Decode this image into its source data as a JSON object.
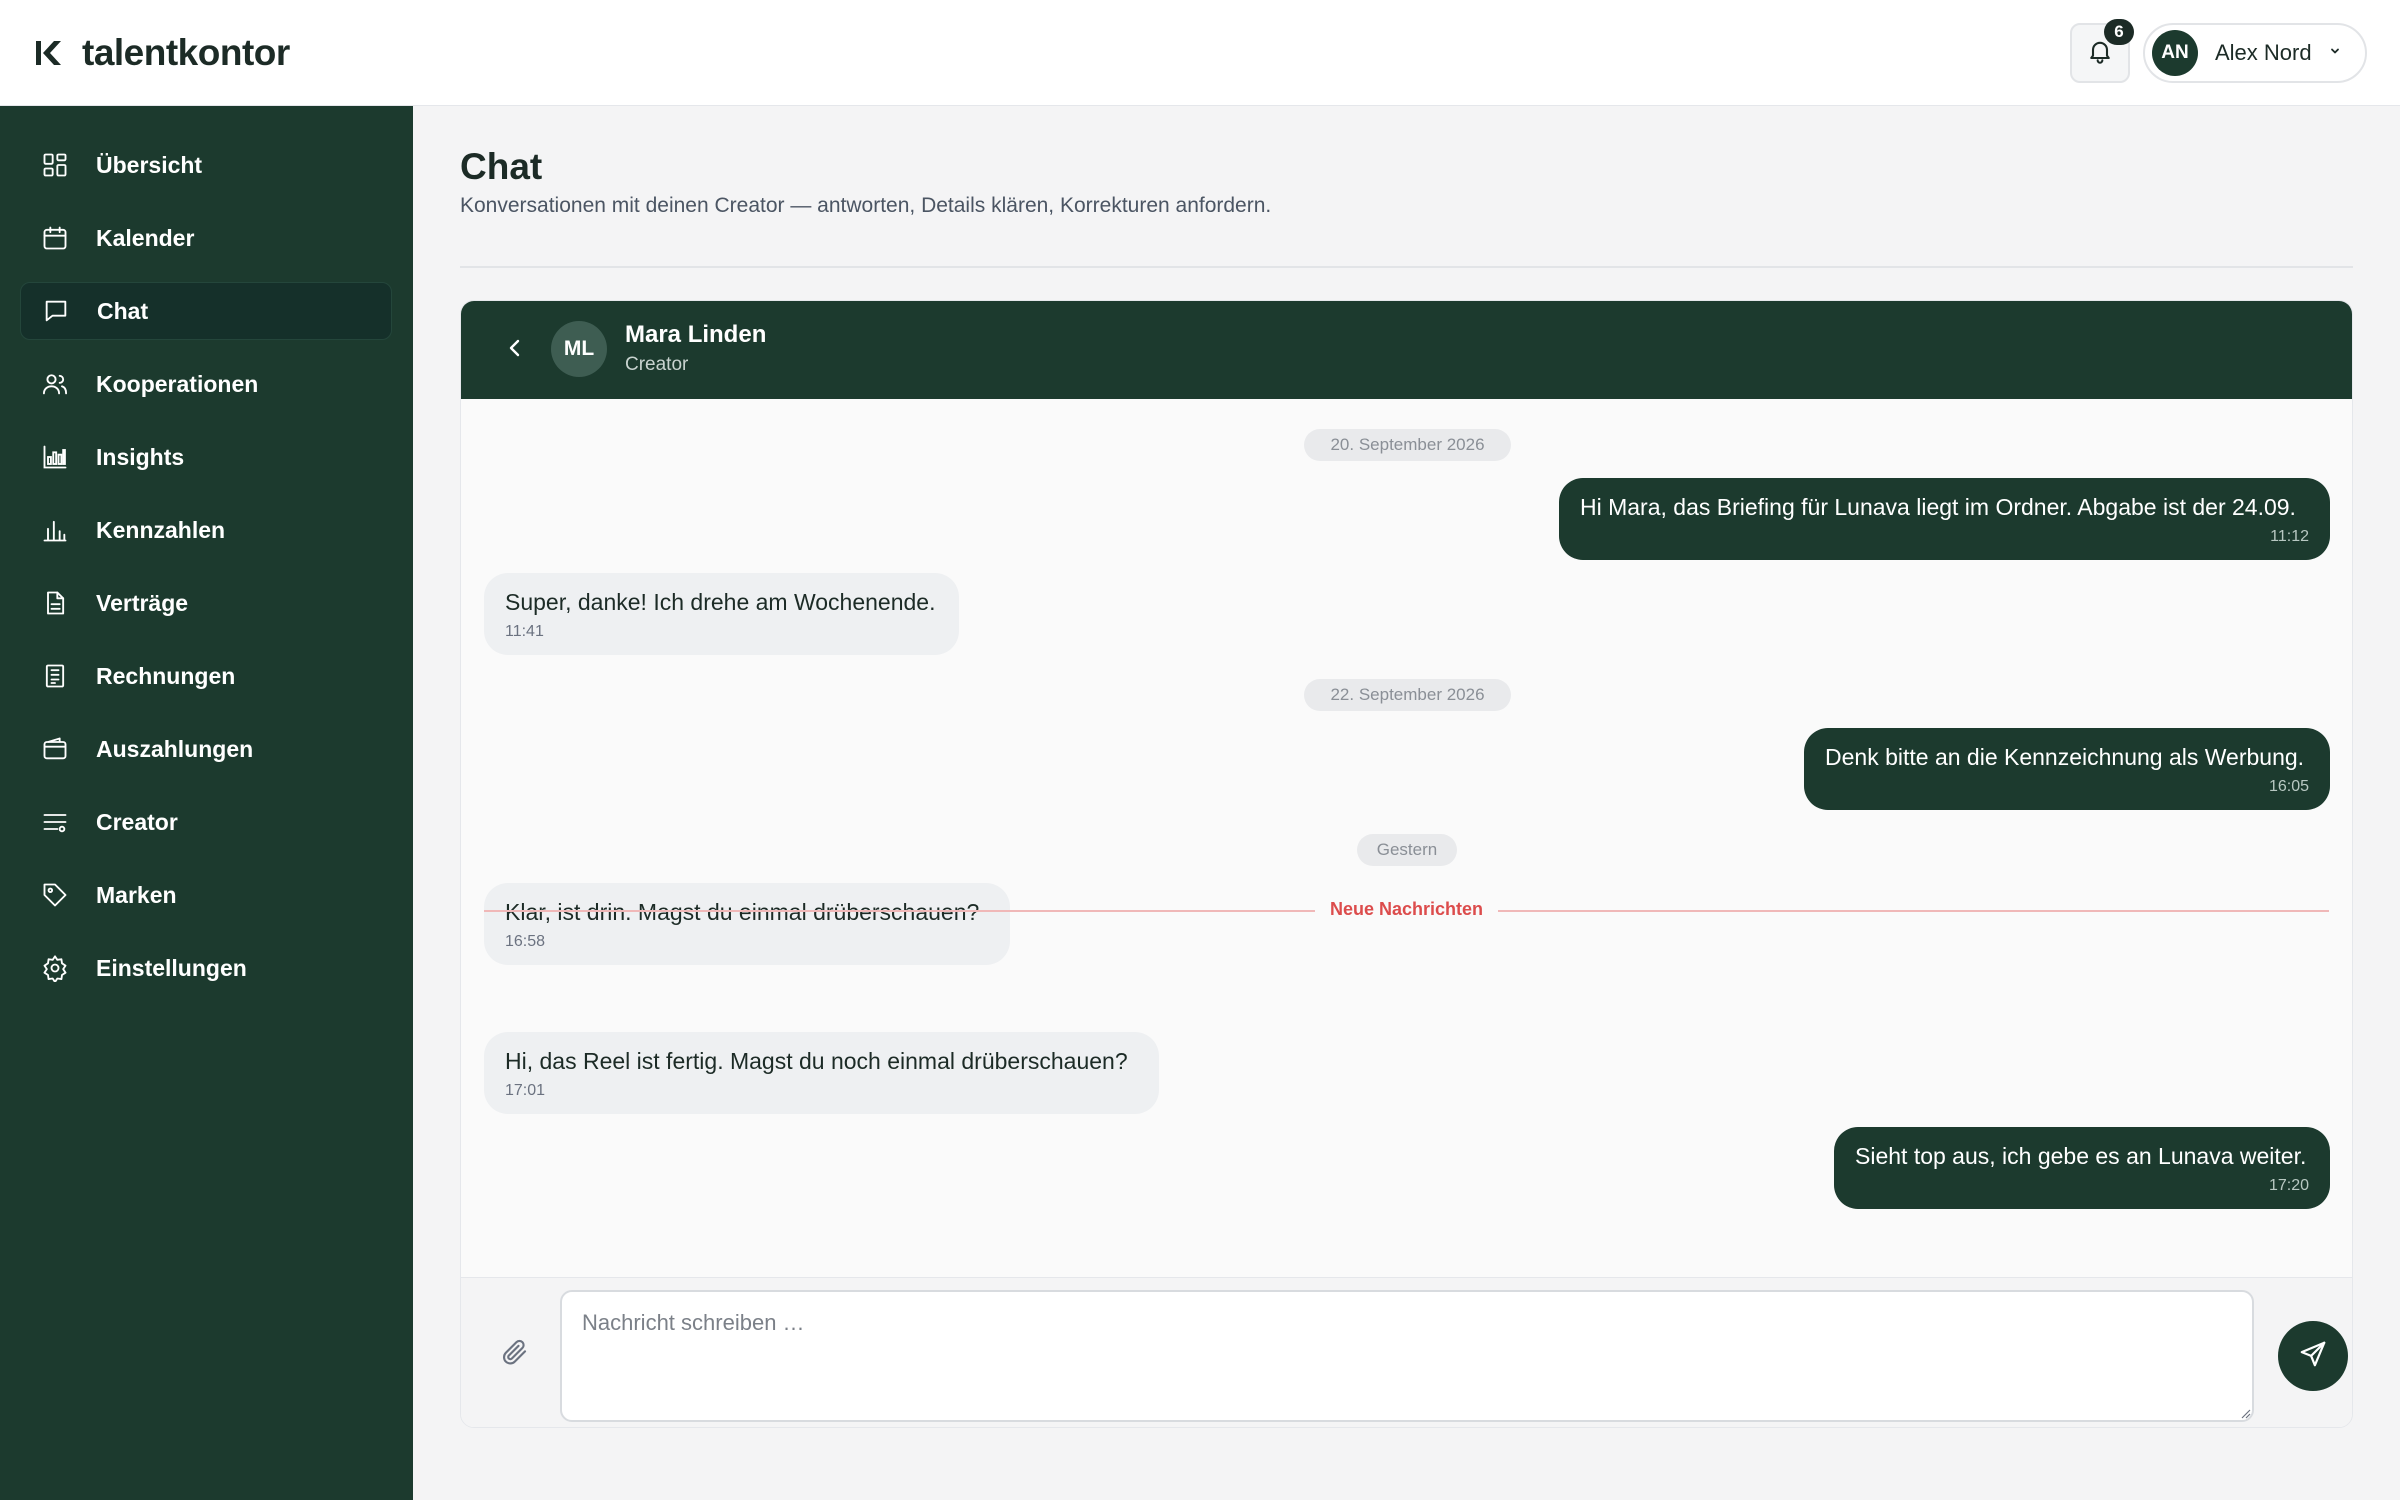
{
  "brand": {
    "name": "talentkontor",
    "logo_icon": "k-logo-icon"
  },
  "header": {
    "notifications_count": "6",
    "user": {
      "initials": "AN",
      "name": "Alex Nord"
    }
  },
  "sidebar": {
    "items": [
      {
        "label": "Übersicht",
        "icon": "grid-icon"
      },
      {
        "label": "Kalender",
        "icon": "calendar-icon"
      },
      {
        "label": "Chat",
        "icon": "chat-icon",
        "active": true
      },
      {
        "label": "Kooperationen",
        "icon": "users-icon"
      },
      {
        "label": "Insights",
        "icon": "bar-chart-icon"
      },
      {
        "label": "Kennzahlen",
        "icon": "metrics-icon"
      },
      {
        "label": "Verträge",
        "icon": "document-icon"
      },
      {
        "label": "Rechnungen",
        "icon": "receipt-icon"
      },
      {
        "label": "Auszahlungen",
        "icon": "wallet-icon"
      },
      {
        "label": "Creator",
        "icon": "list-filter-icon"
      },
      {
        "label": "Marken",
        "icon": "tag-icon"
      },
      {
        "label": "Einstellungen",
        "icon": "gear-icon"
      }
    ]
  },
  "page": {
    "title": "Chat",
    "subtitle": "Konversationen mit deinen Creator — antworten, Details klären, Korrekturen anfordern."
  },
  "chat": {
    "contact": {
      "initials": "ML",
      "name": "Mara Linden",
      "role": "Creator"
    },
    "dates": [
      "20. September 2026",
      "22. September 2026",
      "Gestern"
    ],
    "new_messages_label": "Neue Nachrichten",
    "messages": [
      {
        "direction": "out",
        "text": "Hi Mara, das Briefing für Lunava liegt im Ordner. Abgabe ist der 24.09.",
        "time": "11:12"
      },
      {
        "direction": "in",
        "text": "Super, danke! Ich drehe am Wochenende.",
        "time": "11:41"
      },
      {
        "direction": "out",
        "text": "Denk bitte an die Kennzeichnung als Werbung.",
        "time": "16:05"
      },
      {
        "direction": "in",
        "text": "Klar, ist drin. Magst du einmal drüberschauen?",
        "time": "16:58"
      },
      {
        "direction": "in",
        "text": "Hi, das Reel ist fertig. Magst du noch einmal drüberschauen?",
        "time": "17:01"
      },
      {
        "direction": "out",
        "text": "Sieht top aus, ich gebe es an Lunava weiter.",
        "time": "17:20"
      }
    ],
    "composer": {
      "placeholder": "Nachricht schreiben …",
      "value": ""
    }
  },
  "colors": {
    "primary": "#1c3a2e",
    "background": "#f4f4f5",
    "new_messages": "#dc4c4c"
  }
}
